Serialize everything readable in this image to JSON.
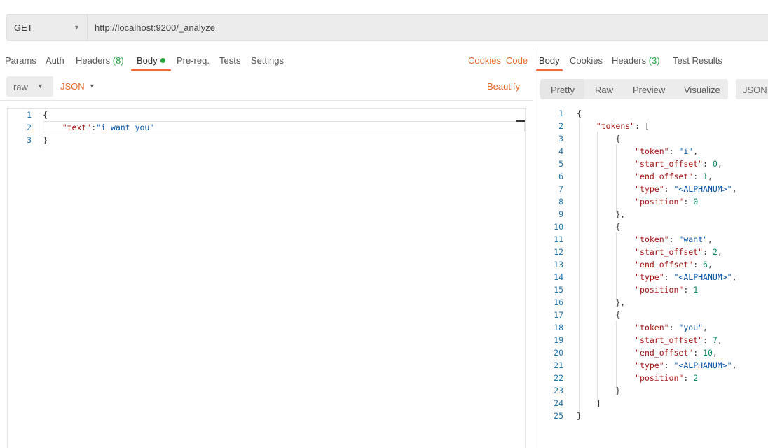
{
  "request": {
    "method": "GET",
    "url": "http://localhost:9200/_analyze"
  },
  "request_tabs": [
    {
      "label": "Params"
    },
    {
      "label": "Auth"
    },
    {
      "label": "Headers",
      "count": "(8)"
    },
    {
      "label": "Body",
      "active": true
    },
    {
      "label": "Pre-req."
    },
    {
      "label": "Tests"
    },
    {
      "label": "Settings"
    }
  ],
  "request_links": {
    "cookies": "Cookies",
    "code": "Code"
  },
  "body_options": {
    "mode": "raw",
    "language": "JSON",
    "beautify": "Beautify"
  },
  "editor": {
    "line_numbers": [
      "1",
      "2",
      "3"
    ],
    "lines": [
      {
        "parts": [
          {
            "t": "{",
            "c": "p"
          }
        ]
      },
      {
        "parts": [
          {
            "t": "    \"text\"",
            "c": "k"
          },
          {
            "t": ":",
            "c": "p"
          },
          {
            "t": "\"i want you\"",
            "c": "s"
          }
        ]
      },
      {
        "parts": [
          {
            "t": "}",
            "c": "p"
          }
        ]
      }
    ]
  },
  "response_tabs": [
    {
      "label": "Body",
      "active": true
    },
    {
      "label": "Cookies"
    },
    {
      "label": "Headers",
      "count": "(3)"
    },
    {
      "label": "Test Results"
    }
  ],
  "response_view": {
    "buttons": [
      "Pretty",
      "Raw",
      "Preview",
      "Visualize"
    ],
    "selected": "Pretty",
    "format": "JSON"
  },
  "response_body": {
    "line_numbers": [
      "1",
      "2",
      "3",
      "4",
      "5",
      "6",
      "7",
      "8",
      "9",
      "10",
      "11",
      "12",
      "13",
      "14",
      "15",
      "16",
      "17",
      "18",
      "19",
      "20",
      "21",
      "22",
      "23",
      "24",
      "25"
    ],
    "lines": [
      {
        "parts": [
          {
            "t": "{",
            "c": "p"
          }
        ]
      },
      {
        "parts": [
          {
            "t": "    ",
            "c": "p"
          },
          {
            "t": "\"tokens\"",
            "c": "k"
          },
          {
            "t": ": [",
            "c": "p"
          }
        ]
      },
      {
        "parts": [
          {
            "t": "        {",
            "c": "p"
          }
        ]
      },
      {
        "parts": [
          {
            "t": "            ",
            "c": "p"
          },
          {
            "t": "\"token\"",
            "c": "k"
          },
          {
            "t": ": ",
            "c": "p"
          },
          {
            "t": "\"i\"",
            "c": "s"
          },
          {
            "t": ",",
            "c": "p"
          }
        ]
      },
      {
        "parts": [
          {
            "t": "            ",
            "c": "p"
          },
          {
            "t": "\"start_offset\"",
            "c": "k"
          },
          {
            "t": ": ",
            "c": "p"
          },
          {
            "t": "0",
            "c": "n"
          },
          {
            "t": ",",
            "c": "p"
          }
        ]
      },
      {
        "parts": [
          {
            "t": "            ",
            "c": "p"
          },
          {
            "t": "\"end_offset\"",
            "c": "k"
          },
          {
            "t": ": ",
            "c": "p"
          },
          {
            "t": "1",
            "c": "n"
          },
          {
            "t": ",",
            "c": "p"
          }
        ]
      },
      {
        "parts": [
          {
            "t": "            ",
            "c": "p"
          },
          {
            "t": "\"type\"",
            "c": "k"
          },
          {
            "t": ": ",
            "c": "p"
          },
          {
            "t": "\"<ALPHANUM>\"",
            "c": "s"
          },
          {
            "t": ",",
            "c": "p"
          }
        ]
      },
      {
        "parts": [
          {
            "t": "            ",
            "c": "p"
          },
          {
            "t": "\"position\"",
            "c": "k"
          },
          {
            "t": ": ",
            "c": "p"
          },
          {
            "t": "0",
            "c": "n"
          }
        ]
      },
      {
        "parts": [
          {
            "t": "        },",
            "c": "p"
          }
        ]
      },
      {
        "parts": [
          {
            "t": "        {",
            "c": "p"
          }
        ]
      },
      {
        "parts": [
          {
            "t": "            ",
            "c": "p"
          },
          {
            "t": "\"token\"",
            "c": "k"
          },
          {
            "t": ": ",
            "c": "p"
          },
          {
            "t": "\"want\"",
            "c": "s"
          },
          {
            "t": ",",
            "c": "p"
          }
        ]
      },
      {
        "parts": [
          {
            "t": "            ",
            "c": "p"
          },
          {
            "t": "\"start_offset\"",
            "c": "k"
          },
          {
            "t": ": ",
            "c": "p"
          },
          {
            "t": "2",
            "c": "n"
          },
          {
            "t": ",",
            "c": "p"
          }
        ]
      },
      {
        "parts": [
          {
            "t": "            ",
            "c": "p"
          },
          {
            "t": "\"end_offset\"",
            "c": "k"
          },
          {
            "t": ": ",
            "c": "p"
          },
          {
            "t": "6",
            "c": "n"
          },
          {
            "t": ",",
            "c": "p"
          }
        ]
      },
      {
        "parts": [
          {
            "t": "            ",
            "c": "p"
          },
          {
            "t": "\"type\"",
            "c": "k"
          },
          {
            "t": ": ",
            "c": "p"
          },
          {
            "t": "\"<ALPHANUM>\"",
            "c": "s"
          },
          {
            "t": ",",
            "c": "p"
          }
        ]
      },
      {
        "parts": [
          {
            "t": "            ",
            "c": "p"
          },
          {
            "t": "\"position\"",
            "c": "k"
          },
          {
            "t": ": ",
            "c": "p"
          },
          {
            "t": "1",
            "c": "n"
          }
        ]
      },
      {
        "parts": [
          {
            "t": "        },",
            "c": "p"
          }
        ]
      },
      {
        "parts": [
          {
            "t": "        {",
            "c": "p"
          }
        ]
      },
      {
        "parts": [
          {
            "t": "            ",
            "c": "p"
          },
          {
            "t": "\"token\"",
            "c": "k"
          },
          {
            "t": ": ",
            "c": "p"
          },
          {
            "t": "\"you\"",
            "c": "s"
          },
          {
            "t": ",",
            "c": "p"
          }
        ]
      },
      {
        "parts": [
          {
            "t": "            ",
            "c": "p"
          },
          {
            "t": "\"start_offset\"",
            "c": "k"
          },
          {
            "t": ": ",
            "c": "p"
          },
          {
            "t": "7",
            "c": "n"
          },
          {
            "t": ",",
            "c": "p"
          }
        ]
      },
      {
        "parts": [
          {
            "t": "            ",
            "c": "p"
          },
          {
            "t": "\"end_offset\"",
            "c": "k"
          },
          {
            "t": ": ",
            "c": "p"
          },
          {
            "t": "10",
            "c": "n"
          },
          {
            "t": ",",
            "c": "p"
          }
        ]
      },
      {
        "parts": [
          {
            "t": "            ",
            "c": "p"
          },
          {
            "t": "\"type\"",
            "c": "k"
          },
          {
            "t": ": ",
            "c": "p"
          },
          {
            "t": "\"<ALPHANUM>\"",
            "c": "s"
          },
          {
            "t": ",",
            "c": "p"
          }
        ]
      },
      {
        "parts": [
          {
            "t": "            ",
            "c": "p"
          },
          {
            "t": "\"position\"",
            "c": "k"
          },
          {
            "t": ": ",
            "c": "p"
          },
          {
            "t": "2",
            "c": "n"
          }
        ]
      },
      {
        "parts": [
          {
            "t": "        }",
            "c": "p"
          }
        ]
      },
      {
        "parts": [
          {
            "t": "    ]",
            "c": "p"
          }
        ]
      },
      {
        "parts": [
          {
            "t": "}",
            "c": "p"
          }
        ]
      }
    ]
  },
  "colors": {
    "accent": "#f26b3a",
    "link": "#e8682b",
    "count_green": "#29a33d",
    "json_key": "#a31515",
    "json_string": "#0451a5",
    "json_number": "#098658",
    "line_number": "#2273aa"
  },
  "icons": {
    "dropdown": "chevron-down-icon",
    "status_dot": "green-dot-icon"
  }
}
